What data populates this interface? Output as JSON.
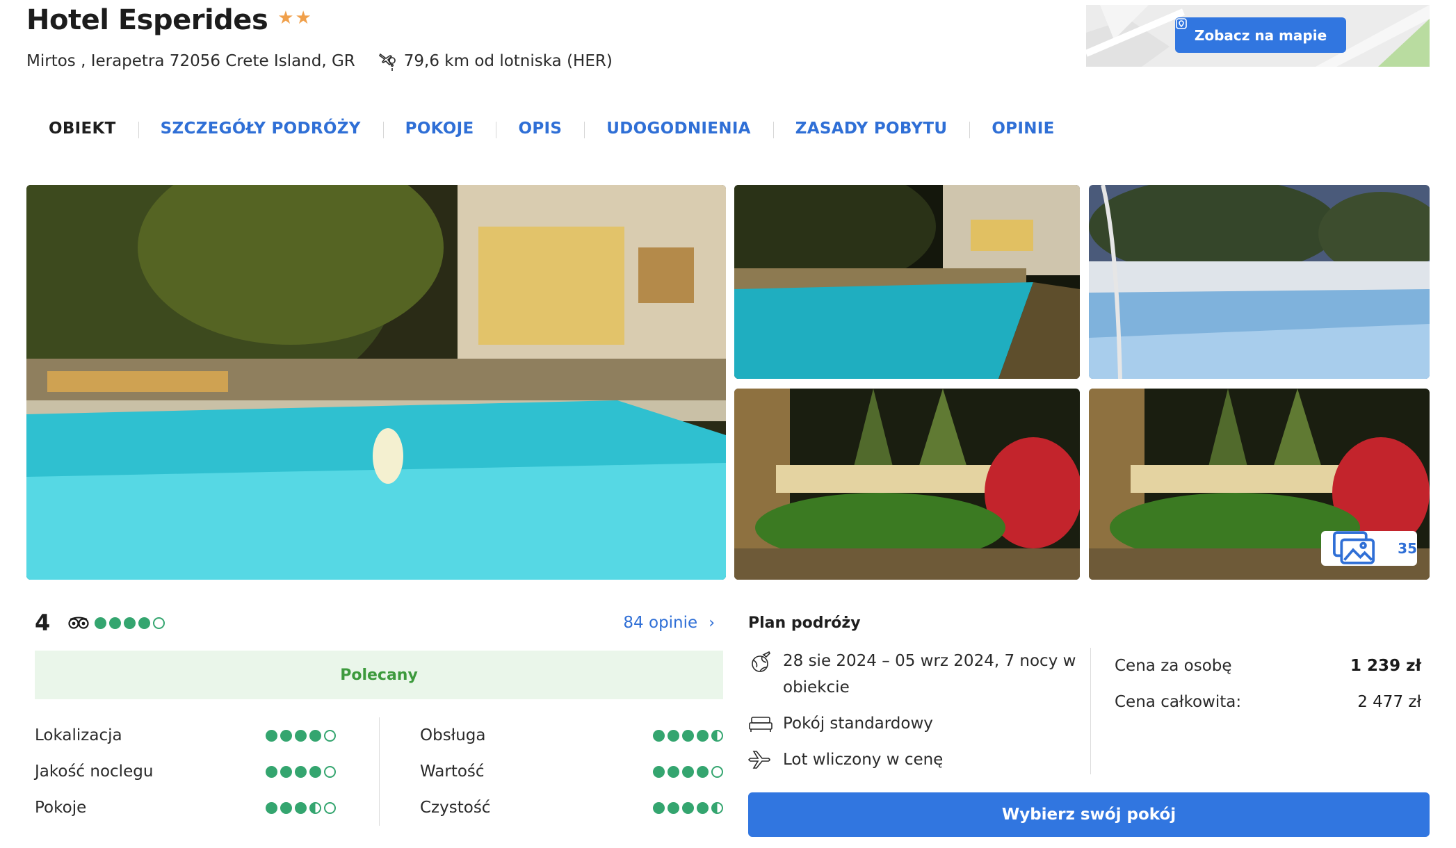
{
  "hotel": {
    "name": "Hotel Esperides",
    "stars": "★★",
    "address": "Mirtos , Ierapetra 72056 Crete Island, GR",
    "airport_distance": "79,6 km od lotniska (HER)"
  },
  "map": {
    "button_label": "Zobacz na mapie"
  },
  "nav": {
    "items": [
      {
        "label": "OBIEKT"
      },
      {
        "label": "SZCZEGÓŁY PODRÓŻY"
      },
      {
        "label": "POKOJE"
      },
      {
        "label": "OPIS"
      },
      {
        "label": "UDOGODNIENIA"
      },
      {
        "label": "ZASADY POBYTU"
      },
      {
        "label": "OPINIE"
      }
    ]
  },
  "gallery": {
    "photo_count": "35"
  },
  "reviews": {
    "score": "4",
    "bubble_rating": 4,
    "link_label": "84 opinie",
    "badge": "Polecany",
    "criteria_left": [
      {
        "label": "Lokalizacja",
        "rating": 4
      },
      {
        "label": "Jakość noclegu",
        "rating": 4
      },
      {
        "label": "Pokoje",
        "rating": 3.5
      }
    ],
    "criteria_right": [
      {
        "label": "Obsługa",
        "rating": 4.5
      },
      {
        "label": "Wartość",
        "rating": 4
      },
      {
        "label": "Czystość",
        "rating": 4.5
      }
    ]
  },
  "plan": {
    "title": "Plan podróży",
    "dates": "28 sie 2024 – 05 wrz 2024, 7 nocy w obiekcie",
    "room": "Pokój standardowy",
    "flight": "Lot wliczony w cenę",
    "price_per_person_label": "Cena za osobę",
    "price_per_person": "1 239 zł",
    "total_label": "Cena całkowita:",
    "total": "2 477 zł"
  },
  "cta": {
    "label": "Wybierz swój pokój"
  },
  "colors": {
    "accent": "#3176e0",
    "rating_green": "#34a56f",
    "star_orange": "#f0a04b",
    "badge_bg": "#eaf6ea"
  }
}
